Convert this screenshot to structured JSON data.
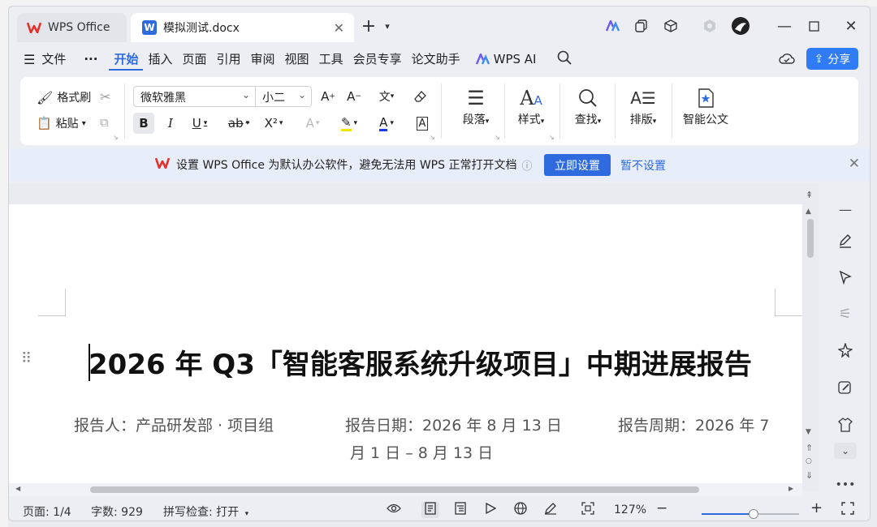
{
  "tabs": [
    {
      "label": "WPS Office",
      "icon": "wps-logo-icon"
    },
    {
      "label": "模拟测试.docx",
      "icon": "word-doc-icon"
    }
  ],
  "menu": [
    "文件",
    "开始",
    "插入",
    "页面",
    "引用",
    "审阅",
    "视图",
    "工具",
    "会员专享",
    "论文助手",
    "WPS AI"
  ],
  "menu_active": "开始",
  "share_label": "分享",
  "ribbon": {
    "format_painter": "格式刷",
    "paste": "粘贴",
    "font_name": "微软雅黑",
    "font_size": "小二",
    "paragraph": "段落",
    "styles": "样式",
    "find": "查找",
    "layout": "排版",
    "smart_doc": "智能公文"
  },
  "notice": {
    "text": "设置 WPS Office 为默认办公软件，避免无法用 WPS 正常打开文档",
    "primary": "立即设置",
    "secondary": "暂不设置"
  },
  "document": {
    "title": "2026 年 Q3「智能客服系统升级项目」中期进展报告",
    "reporter": "报告人：产品研发部 · 项目组",
    "report_date": "报告日期：2026 年 8 月 13 日",
    "period_part1": "报告周期：2026 年 7",
    "period_part2": "月 1 日 – 8 月 13 日"
  },
  "status": {
    "page": "页面: 1/4",
    "words": "字数: 929",
    "spell": "拼写检查: 打开",
    "zoom": "127%",
    "zoom_level": 0.53
  },
  "colors": {
    "accent": "#2f6bdf",
    "wps_red": "#e3312d"
  }
}
